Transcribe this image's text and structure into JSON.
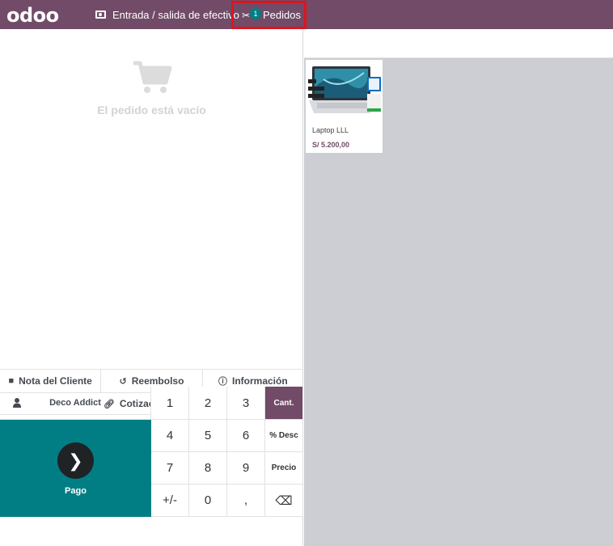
{
  "header": {
    "logo": "odoo",
    "cash_label": "Entrada / salida de efectivo",
    "orders_label": "Pedidos",
    "orders_badge": "1"
  },
  "order": {
    "empty_text": "El pedido está vacío"
  },
  "controls": {
    "customer_note": "Nota del Cliente",
    "refund": "Reembolso",
    "info": "Información",
    "quotation": "Cotización/Orden"
  },
  "customer": {
    "name": "Deco Addict"
  },
  "payment": {
    "label": "Pago"
  },
  "numpad": {
    "keys": [
      "1",
      "2",
      "3",
      "Cant.",
      "4",
      "5",
      "6",
      "% Desc",
      "7",
      "8",
      "9",
      "Precio",
      "+/-",
      "0",
      ",",
      "⌫"
    ],
    "active_mode": "Cant."
  },
  "products": [
    {
      "name": "Laptop LLL",
      "price": "S/ 5.200,00"
    }
  ],
  "colors": {
    "brand": "#714b67",
    "teal": "#017e84",
    "highlight": "#e0131c"
  }
}
